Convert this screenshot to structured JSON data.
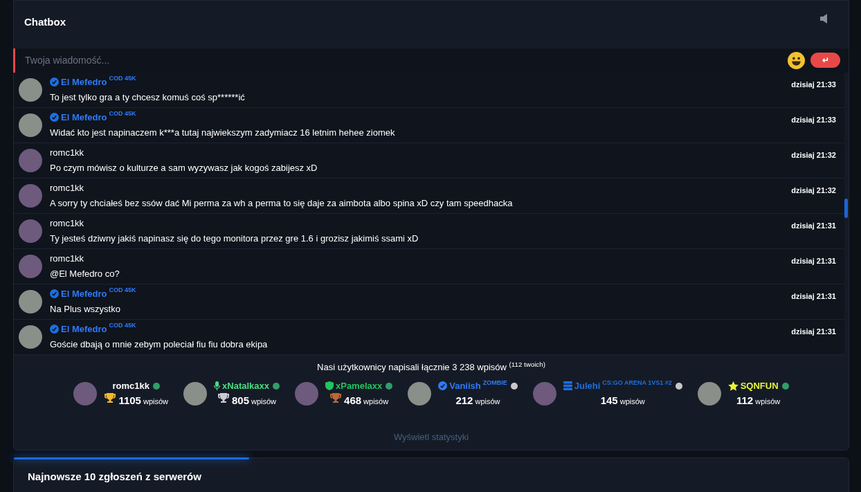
{
  "chatbox": {
    "title": "Chatbox",
    "input": {
      "placeholder": "Twoja wiadomość..."
    },
    "send_button": {
      "label": "↵"
    },
    "messages": [
      {
        "author": "El Mefedro",
        "verified": true,
        "tag": "COD 45K",
        "text": "To jest tylko gra a ty chcesz komuś coś sp******ić",
        "time": "dzisiaj 21:33"
      },
      {
        "author": "El Mefedro",
        "verified": true,
        "tag": "COD 45K",
        "text": "Widać kto jest napinaczem k***a tutaj najwiekszym zadymiacz 16 letnim hehee ziomek",
        "time": "dzisiaj 21:33"
      },
      {
        "author": "romc1kk",
        "verified": false,
        "text": "Po czym mówisz o kulturze a sam wyzywasz jak kogoś zabijesz xD",
        "time": "dzisiaj 21:32"
      },
      {
        "author": "romc1kk",
        "verified": false,
        "text": "A sorry ty chciałeś bez ssów dać Mi perma za wh a perma to się daje za aimbota albo spina xD czy tam speedhacka",
        "time": "dzisiaj 21:32"
      },
      {
        "author": "romc1kk",
        "verified": false,
        "text": "Ty jesteś dziwny jakiś napinasz się do tego monitora przez gre 1.6 i grozisz jakimiś ssami xD",
        "time": "dzisiaj 21:31"
      },
      {
        "author": "romc1kk",
        "verified": false,
        "text": "@El Mefedro co?",
        "time": "dzisiaj 21:31"
      },
      {
        "author": "El Mefedro",
        "verified": true,
        "tag": "COD 45K",
        "text": "Na Plus wszystko",
        "time": "dzisiaj 21:31"
      },
      {
        "author": "El Mefedro",
        "verified": true,
        "tag": "COD 45K",
        "text": "Goście dbają o mnie zebym poleciał fiu fiu dobra ekipa",
        "time": "dzisiaj 21:31"
      }
    ],
    "summary": "Nasi użytkownicy napisali łącznie 3 238 wpisów $^{(112 twoich)}$",
    "top_users": [
      {
        "name": "romc1kk",
        "color": "#ffffff",
        "online": true,
        "trophy": {
          "kind": "gold"
        },
        "count": "1105",
        "unit": "wpisów"
      },
      {
        "name": "xNatalkaxx",
        "color": "#4ade80",
        "badge": {
          "kind": "mic"
        },
        "online": true,
        "trophy": {
          "kind": "silver"
        },
        "count": "805",
        "unit": "wpisów"
      },
      {
        "name": "xPamelaxx",
        "color": "#22c55e",
        "badge": {
          "kind": "shield"
        },
        "online": true,
        "trophy": {
          "kind": "bronze"
        },
        "count": "468",
        "unit": "wpisów"
      },
      {
        "name": "Vaniish",
        "color": "#2f7bf5",
        "badge": {
          "kind": "verified"
        },
        "tag": "ZOMBIE",
        "online": false,
        "count": "212",
        "unit": "wpisów"
      },
      {
        "name": "Julehi",
        "color": "#1d6fe0",
        "badge": {
          "kind": "server"
        },
        "tag": "CS:GO ARENA 1VS1 #2",
        "online": false,
        "count": "145",
        "unit": "wpisów"
      },
      {
        "name": "SQNFUN",
        "color": "#e6f53a",
        "badge": {
          "kind": "star"
        },
        "online": true,
        "count": "112",
        "unit": "wpisów"
      }
    ],
    "stats_link": "Wyświetl statystyki"
  },
  "reports": {
    "title": "Najnowsze 10 zgłoszeń z serwerów"
  }
}
